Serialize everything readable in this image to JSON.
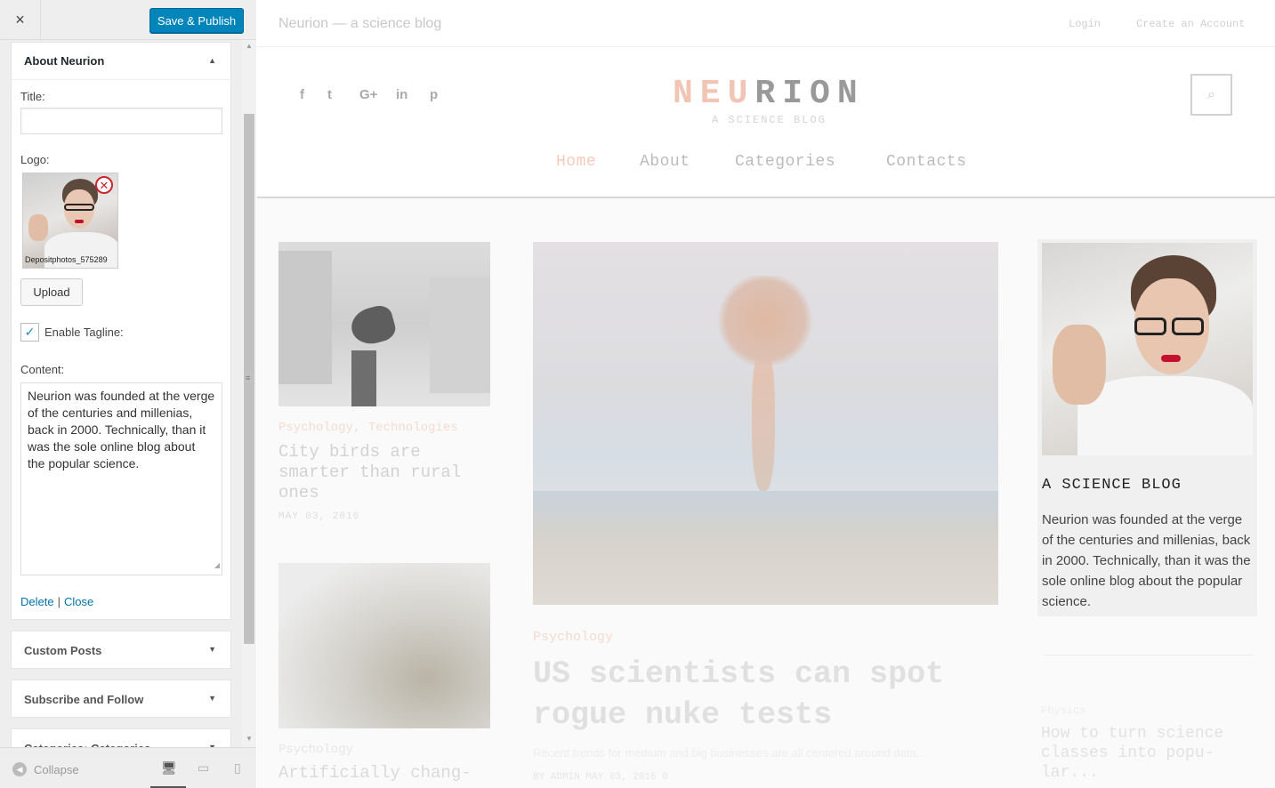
{
  "sidebar": {
    "close_icon": "×",
    "save_label": "Save & Publish",
    "about_panel": {
      "title": "About Neurion",
      "title_label": "Title:",
      "title_value": "",
      "logo_label": "Logo:",
      "logo_filename": "Depositphotos_575289",
      "upload_label": "Upload",
      "tagline_label": "Enable Tagline:",
      "tagline_checked": true,
      "content_label": "Content:",
      "content_value": "Neurion was founded at the verge of the centuries and millenias, back in 2000. Technically, than it was the sole online blog about the popular science.",
      "delete_label": "Delete",
      "separator": "|",
      "close_label": "Close"
    },
    "collapsed_panels": [
      "Custom Posts",
      "Subscribe and Follow",
      "Categories: Categories"
    ],
    "footer": {
      "collapse_label": "Collapse"
    }
  },
  "preview": {
    "site_tagline": "Neurion — a science blog",
    "login": "Login",
    "register": "Create an Account",
    "social_icons": [
      "facebook-icon",
      "twitter-icon",
      "google-plus-icon",
      "linkedin-icon",
      "pinterest-icon"
    ],
    "social_glyphs": [
      "f",
      "t",
      "G+",
      "in",
      "p"
    ],
    "logo": {
      "accent": "NEU",
      "rest": "RION",
      "subtitle": "A SCIENCE BLOG"
    },
    "nav": [
      "Home",
      "About",
      "Categories",
      "Contacts"
    ],
    "posts": [
      {
        "categories": "Psychology, Technologies",
        "title": "City birds are smarter than rural ones",
        "date": "MAY 03, 2016"
      },
      {
        "categories": "Psychology",
        "title": "Artificially chang-"
      },
      {
        "categories": "Psychology",
        "title": "US scientists can spot rogue nuke tests",
        "excerpt": "Recent trends for medium and big businesses are all centered around data...",
        "meta": "BY ADMIN     MAY 03, 2016     0"
      },
      {
        "categories": "Physics",
        "title": "How to turn science classes into popu-lar..."
      }
    ],
    "widget": {
      "title": "A SCIENCE BLOG",
      "text": "Neurion was founded at the verge of the centuries and millenias, back in 2000. Technically, than it was the sole online blog about the popular science."
    }
  },
  "colors": {
    "primary": "#0085ba",
    "accent": "#f2c4b4",
    "remove": "#c9262f"
  }
}
